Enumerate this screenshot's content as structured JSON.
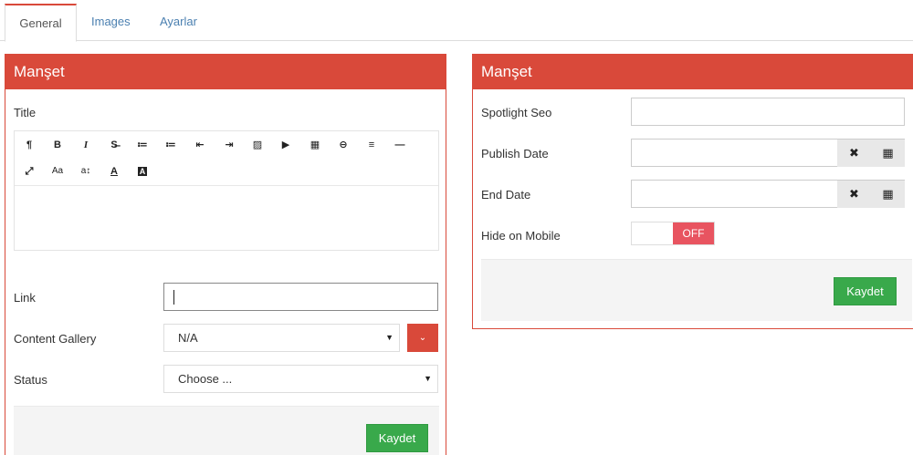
{
  "tabs": [
    "General",
    "Images",
    "Ayarlar"
  ],
  "left_panel": {
    "title": "Manşet",
    "title_label": "Title",
    "toolbar_row1": [
      "¶",
      "B",
      "I",
      "S̶",
      "≔",
      "≔",
      "⇤",
      "⇥",
      "▨",
      "▶",
      "▦",
      "⊖",
      "≡",
      "—"
    ],
    "toolbar_row2": [
      "⤢",
      "Aa",
      "a↕",
      "A",
      "A"
    ],
    "link_label": "Link",
    "link_value": "",
    "gallery_label": "Content Gallery",
    "gallery_value": "N/A",
    "gallery_arrow": "▼",
    "gallery_btn_icon": "⌄",
    "status_label": "Status",
    "status_value": "Choose ...",
    "status_arrow": "▼",
    "save_label": "Kaydet"
  },
  "right_panel": {
    "title": "Manşet",
    "spotlight_label": "Spotlight Seo",
    "publish_label": "Publish Date",
    "end_label": "End Date",
    "clear_icon": "✖",
    "calendar_icon": "▦",
    "hide_mobile_label": "Hide on Mobile",
    "toggle_state": "OFF",
    "save_label": "Kaydet"
  },
  "colors": {
    "accent_red": "#d9493a",
    "save_green": "#39a94b",
    "toggle_off": "#e85460",
    "tab_link": "#4a7fb0"
  }
}
